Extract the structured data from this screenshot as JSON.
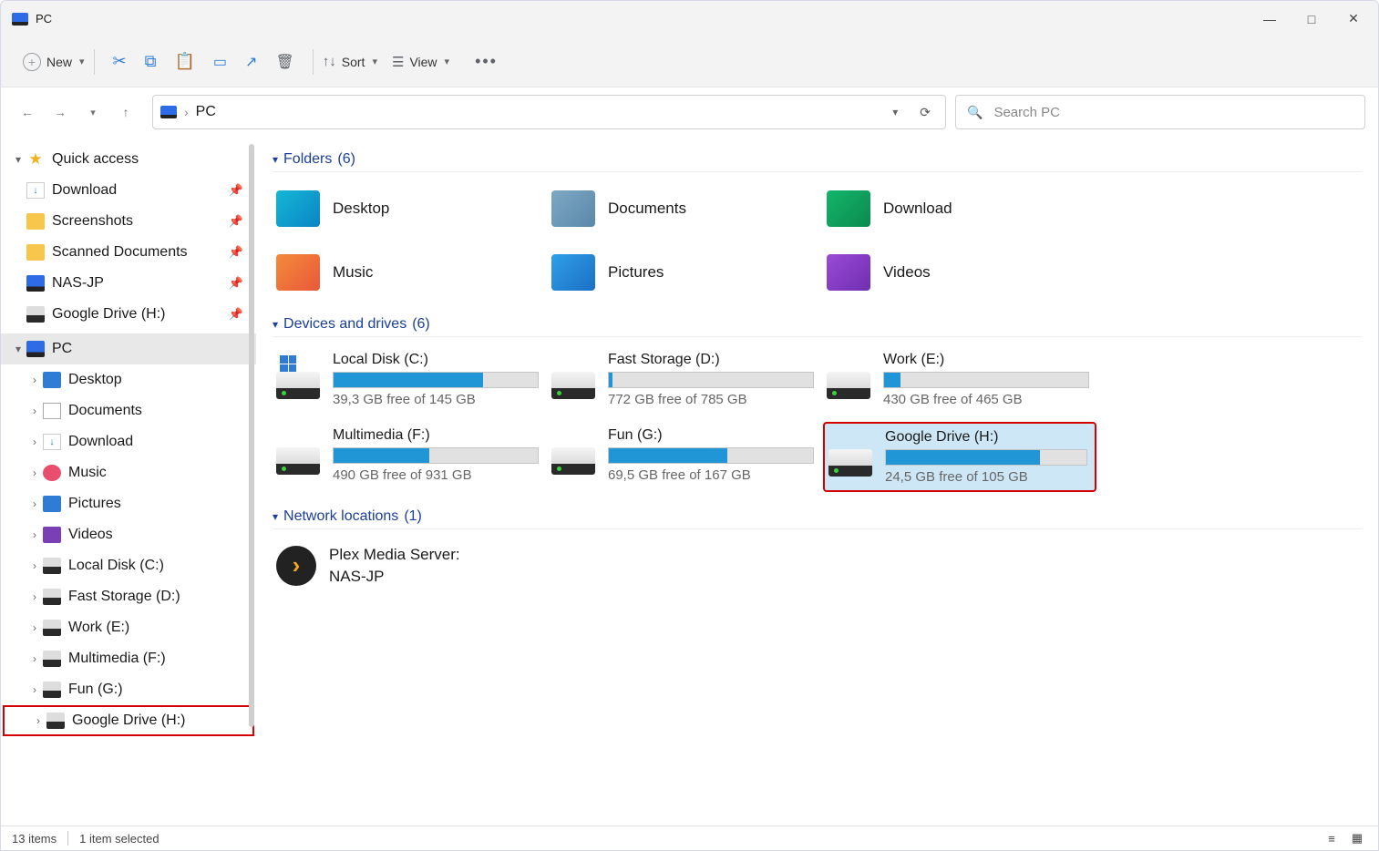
{
  "window": {
    "title": "PC"
  },
  "toolbar": {
    "new_label": "New",
    "sort_label": "Sort",
    "view_label": "View"
  },
  "address": {
    "location": "PC"
  },
  "search": {
    "placeholder": "Search PC"
  },
  "sidebar": {
    "quick_access": "Quick access",
    "pinned": [
      {
        "label": "Download"
      },
      {
        "label": "Screenshots"
      },
      {
        "label": "Scanned Documents"
      },
      {
        "label": "NAS-JP"
      },
      {
        "label": "Google Drive (H:)"
      }
    ],
    "pc": "PC",
    "pc_children": [
      {
        "label": "Desktop"
      },
      {
        "label": "Documents"
      },
      {
        "label": "Download"
      },
      {
        "label": "Music"
      },
      {
        "label": "Pictures"
      },
      {
        "label": "Videos"
      },
      {
        "label": "Local Disk (C:)"
      },
      {
        "label": "Fast Storage (D:)"
      },
      {
        "label": "Work (E:)"
      },
      {
        "label": "Multimedia (F:)"
      },
      {
        "label": "Fun (G:)"
      },
      {
        "label": "Google Drive (H:)"
      }
    ]
  },
  "sections": {
    "folders_header": "Folders",
    "folders_count": "(6)",
    "drives_header": "Devices and drives",
    "drives_count": "(6)",
    "network_header": "Network locations",
    "network_count": "(1)"
  },
  "folders": [
    {
      "name": "Desktop",
      "color": "linear-gradient(135deg,#15b7d6,#0a84c4)"
    },
    {
      "name": "Documents",
      "color": "linear-gradient(135deg,#7ea8c4,#5a88aa)"
    },
    {
      "name": "Download",
      "color": "linear-gradient(135deg,#14b56b,#0a8a4e)"
    },
    {
      "name": "Music",
      "color": "linear-gradient(135deg,#f48a3a,#e9583a)"
    },
    {
      "name": "Pictures",
      "color": "linear-gradient(135deg,#2f9fe8,#1c6fc4)"
    },
    {
      "name": "Videos",
      "color": "linear-gradient(135deg,#9a4bd6,#6f2eb0)"
    }
  ],
  "drives": [
    {
      "name": "Local Disk (C:)",
      "free": "39,3 GB free of 145 GB",
      "fill": 73
    },
    {
      "name": "Fast Storage (D:)",
      "free": "772 GB free of 785 GB",
      "fill": 2
    },
    {
      "name": "Work (E:)",
      "free": "430 GB free of 465 GB",
      "fill": 8
    },
    {
      "name": "Multimedia (F:)",
      "free": "490 GB free of 931 GB",
      "fill": 47
    },
    {
      "name": "Fun (G:)",
      "free": "69,5 GB free of 167 GB",
      "fill": 58
    },
    {
      "name": "Google Drive (H:)",
      "free": "24,5 GB free of 105 GB",
      "fill": 77,
      "selected": true
    }
  ],
  "network": [
    {
      "line1": "Plex Media Server:",
      "line2": "NAS-JP"
    }
  ],
  "status": {
    "items": "13 items",
    "selected": "1 item selected"
  }
}
